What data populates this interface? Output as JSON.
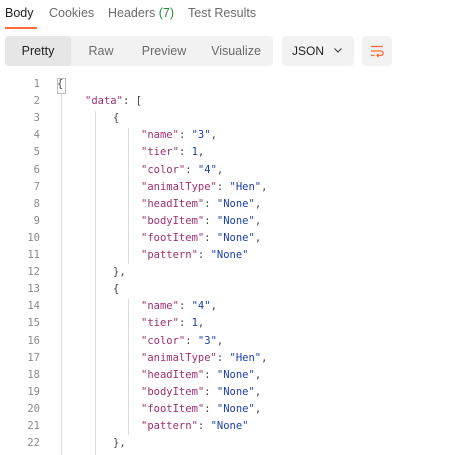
{
  "tabs": [
    {
      "label": "Body"
    },
    {
      "label": "Cookies"
    },
    {
      "label": "Headers",
      "count": "(7)"
    },
    {
      "label": "Test Results"
    }
  ],
  "view_modes": [
    "Pretty",
    "Raw",
    "Preview",
    "Visualize"
  ],
  "active_view_mode": "Pretty",
  "format": "JSON",
  "icons": {
    "format_chevron": "chevron-down-icon",
    "wrap": "wrap-lines-icon"
  },
  "colors": {
    "accent": "#ff6c37",
    "key": "#a0306e",
    "string": "#1c3eaa",
    "count": "#2a8a3a"
  },
  "code": {
    "line_numbers": [
      "1",
      "2",
      "3",
      "4",
      "5",
      "6",
      "7",
      "8",
      "9",
      "10",
      "11",
      "12",
      "13",
      "14",
      "15",
      "16",
      "17",
      "18",
      "19",
      "20",
      "21",
      "22"
    ],
    "lines": [
      "{",
      "\"data\": [",
      "{",
      "\"name\": \"3\",",
      "\"tier\": 1,",
      "\"color\": \"4\",",
      "\"animalType\": \"Hen\",",
      "\"headItem\": \"None\",",
      "\"bodyItem\": \"None\",",
      "\"footItem\": \"None\",",
      "\"pattern\": \"None\"",
      "},",
      "{",
      "\"name\": \"4\",",
      "\"tier\": 1,",
      "\"color\": \"3\",",
      "\"animalType\": \"Hen\",",
      "\"headItem\": \"None\",",
      "\"bodyItem\": \"None\",",
      "\"footItem\": \"None\",",
      "\"pattern\": \"None\"",
      "},"
    ]
  }
}
